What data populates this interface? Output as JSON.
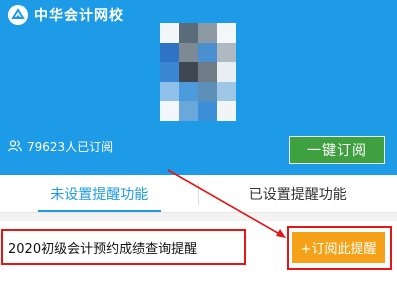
{
  "brand": {
    "name": "中华会计网校",
    "logo_icon": "chinaacc-logo-icon"
  },
  "cover_colors": [
    "#f2f6f9",
    "#5a6b7a",
    "#8d9aa3",
    "#f3f7fa",
    "#2f74c4",
    "#7d8a95",
    "#4a8fd0",
    "#aeb9c2",
    "#3a86d3",
    "#3f4852",
    "#6f7c88",
    "#e9eef2",
    "#8fc1ea",
    "#4b9bdd",
    "#5d8fb8",
    "#9ec7e6",
    "#f4f7fa",
    "#6aa8dc",
    "#3c8fd6",
    "#f1f5f8"
  ],
  "subscribers": {
    "icon": "users-icon",
    "text": "79623人已订阅"
  },
  "subscribe_button": {
    "label": "一键订阅"
  },
  "tabs": [
    {
      "label": "未设置提醒功能",
      "active": true
    },
    {
      "label": "已设置提醒功能",
      "active": false
    }
  ],
  "item": {
    "title": "2020初级会计预约成绩查询提醒",
    "action_label": "+订阅此提醒"
  },
  "colors": {
    "header": "#1e9be6",
    "subscribe_button": "#3fa040",
    "remind_button": "#f5a218",
    "annotation": "#e41717"
  }
}
